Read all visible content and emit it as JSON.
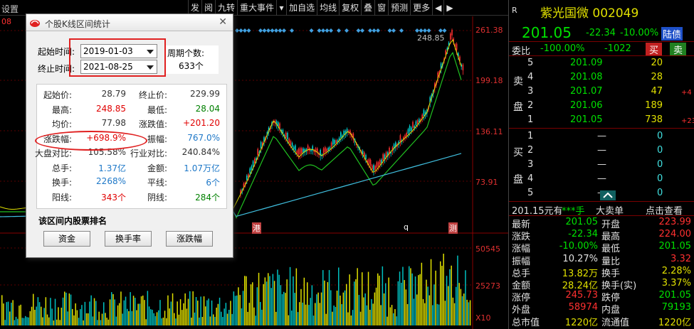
{
  "toolbar": {
    "settings_label": "设置",
    "price_label": "08",
    "buttons": [
      "发",
      "阅",
      "九转",
      "重大事件",
      "加自选",
      "均线",
      "复权",
      "叠",
      "窗",
      "预测",
      "更多"
    ]
  },
  "chart_axis": {
    "price_ticks": [
      "261.38",
      "199.18",
      "136.11",
      "73.91"
    ],
    "volume_ticks": [
      "50545",
      "25273",
      "X10"
    ],
    "peak_label": "248.85",
    "markers": [
      "港",
      "q",
      "测"
    ]
  },
  "colors": {
    "up": "#ff3030",
    "down": "#00e0e0",
    "ma_yellow": "#e0e000",
    "ma_green": "#20c020",
    "ma_cyan": "#40c0e0"
  },
  "dialog": {
    "title": "个股K线区间统计",
    "start_label": "起始时间:",
    "start_value": "2019-01-03",
    "end_label": "终止时间:",
    "end_value": "2021-08-25",
    "period_label": "周期个数:",
    "period_value": "633个",
    "stats": [
      {
        "l1": "起始价:",
        "v1": "28.79",
        "c1": "dark",
        "l2": "终止价:",
        "v2": "229.99",
        "c2": "dark"
      },
      {
        "l1": "最高:",
        "v1": "248.85",
        "c1": "red",
        "l2": "最低:",
        "v2": "28.04",
        "c2": "green"
      },
      {
        "l1": "均价:",
        "v1": "77.98",
        "c1": "dark",
        "l2": "涨跌值:",
        "v2": "+201.20",
        "c2": "red"
      },
      {
        "l1": "涨跌幅:",
        "v1": "+698.9%",
        "c1": "red",
        "l2": "振幅:",
        "v2": "767.0%",
        "c2": "blue"
      },
      {
        "l1": "大盘对比:",
        "v1": "105.58%",
        "c1": "dark",
        "l2": "行业对比:",
        "v2": "240.84%",
        "c2": "dark"
      },
      {
        "l1": "总手:",
        "v1": "1.37亿",
        "c1": "blue",
        "l2": "金额:",
        "v2": "1.07万亿",
        "c2": "blue"
      },
      {
        "l1": "换手:",
        "v1": "2268%",
        "c1": "blue",
        "l2": "平线:",
        "v2": "6个",
        "c2": "blue"
      },
      {
        "l1": "阳线:",
        "v1": "343个",
        "c1": "red",
        "l2": "阴线:",
        "v2": "284个",
        "c2": "green"
      }
    ],
    "rank_title": "该区间内股票排名",
    "rank_buttons": [
      "资金",
      "换手率",
      "涨跌幅"
    ]
  },
  "quote": {
    "market_tag": "R",
    "name_code": "紫光国微 002049",
    "price": "201.05",
    "change": "-22.34",
    "change_pct": "-10.00%",
    "status": "陆债",
    "weibi_label": "委比",
    "weibi_value": "-100.00%",
    "weicha_value": "-1022",
    "buy_btn": "买",
    "sell_btn": "卖",
    "sell_label": [
      "卖",
      "盘"
    ],
    "buy_label": [
      "买",
      "盘"
    ],
    "sell_orders": [
      {
        "lvl": "5",
        "price": "201.09",
        "vol": "20",
        "chg": ""
      },
      {
        "lvl": "4",
        "price": "201.08",
        "vol": "28",
        "chg": ""
      },
      {
        "lvl": "3",
        "price": "201.07",
        "vol": "47",
        "chg": "+4"
      },
      {
        "lvl": "2",
        "price": "201.06",
        "vol": "189",
        "chg": ""
      },
      {
        "lvl": "1",
        "price": "201.05",
        "vol": "738",
        "chg": "+23"
      }
    ],
    "buy_orders": [
      {
        "lvl": "1",
        "price": "—",
        "vol": "0"
      },
      {
        "lvl": "2",
        "price": "—",
        "vol": "0"
      },
      {
        "lvl": "3",
        "price": "—",
        "vol": "0"
      },
      {
        "lvl": "4",
        "price": "—",
        "vol": "0"
      },
      {
        "lvl": "5",
        "price": "—",
        "vol": "0"
      }
    ],
    "tick_price": "201.15元有",
    "tick_hand": "***手",
    "bigorder": "大卖单",
    "click_view": "点击查看",
    "details": [
      {
        "l1": "最新",
        "v1": "201.05",
        "c1": "gr",
        "l2": "开盘",
        "v2": "223.99",
        "c2": "rd"
      },
      {
        "l1": "涨跌",
        "v1": "-22.34",
        "c1": "gr",
        "l2": "最高",
        "v2": "224.00",
        "c2": "rd"
      },
      {
        "l1": "涨幅",
        "v1": "-10.00%",
        "c1": "gr",
        "l2": "最低",
        "v2": "201.05",
        "c2": "gr"
      },
      {
        "l1": "振幅",
        "v1": "10.27%",
        "c1": "wt",
        "l2": "量比",
        "v2": "3.32",
        "c2": "rd"
      },
      {
        "l1": "总手",
        "v1": "13.82万",
        "c1": "yl",
        "l2": "换手",
        "v2": "2.28%",
        "c2": "yl"
      },
      {
        "l1": "金额",
        "v1": "28.24亿",
        "c1": "yl",
        "l2": "换手(实)",
        "v2": "3.37%",
        "c2": "yl"
      },
      {
        "l1": "涨停",
        "v1": "245.73",
        "c1": "rd",
        "l2": "跌停",
        "v2": "201.05",
        "c2": "gr"
      },
      {
        "l1": "外盘",
        "v1": "58974",
        "c1": "rd",
        "l2": "内盘",
        "v2": "79193",
        "c2": "gr"
      },
      {
        "l1": "总市值",
        "v1": "1220亿",
        "c1": "yl",
        "l2": "流通值",
        "v2": "1220亿",
        "c2": "yl"
      }
    ]
  }
}
